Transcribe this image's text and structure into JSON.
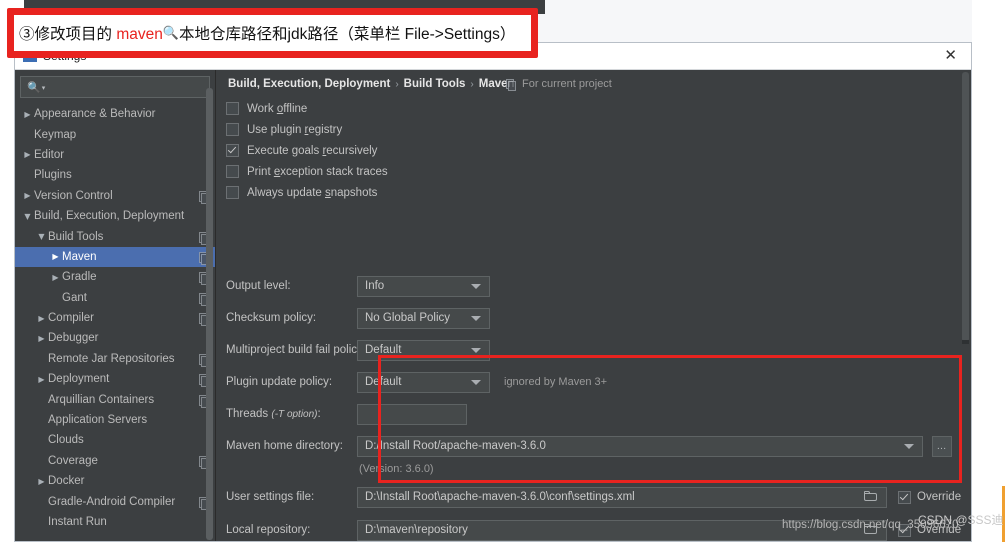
{
  "annotation": {
    "prefix": "③修改项目的 ",
    "keyword": "maven",
    "magnifier_icon": "search-icon",
    "suffix": "本地仓库路径和jdk路径（菜单栏 File->Settings）"
  },
  "dialog": {
    "title": "Settings",
    "close_label": "✕",
    "search_placeholder": "",
    "search_icon": "search-icon"
  },
  "sidebar": {
    "items": [
      {
        "label": "Appearance & Behavior",
        "arrow": "▶",
        "indent": 0,
        "badge": false,
        "selected": false
      },
      {
        "label": "Keymap",
        "arrow": "",
        "indent": 0,
        "badge": false,
        "selected": false
      },
      {
        "label": "Editor",
        "arrow": "▶",
        "indent": 0,
        "badge": false,
        "selected": false
      },
      {
        "label": "Plugins",
        "arrow": "",
        "indent": 0,
        "badge": false,
        "selected": false
      },
      {
        "label": "Version Control",
        "arrow": "▶",
        "indent": 0,
        "badge": true,
        "selected": false
      },
      {
        "label": "Build, Execution, Deployment",
        "arrow": "▼",
        "indent": 0,
        "badge": false,
        "selected": false
      },
      {
        "label": "Build Tools",
        "arrow": "▼",
        "indent": 1,
        "badge": true,
        "selected": false
      },
      {
        "label": "Maven",
        "arrow": "▶",
        "indent": 2,
        "badge": true,
        "selected": true
      },
      {
        "label": "Gradle",
        "arrow": "▶",
        "indent": 2,
        "badge": true,
        "selected": false
      },
      {
        "label": "Gant",
        "arrow": "",
        "indent": 2,
        "badge": true,
        "selected": false
      },
      {
        "label": "Compiler",
        "arrow": "▶",
        "indent": 1,
        "badge": true,
        "selected": false
      },
      {
        "label": "Debugger",
        "arrow": "▶",
        "indent": 1,
        "badge": false,
        "selected": false
      },
      {
        "label": "Remote Jar Repositories",
        "arrow": "",
        "indent": 1,
        "badge": true,
        "selected": false
      },
      {
        "label": "Deployment",
        "arrow": "▶",
        "indent": 1,
        "badge": true,
        "selected": false
      },
      {
        "label": "Arquillian Containers",
        "arrow": "",
        "indent": 1,
        "badge": true,
        "selected": false
      },
      {
        "label": "Application Servers",
        "arrow": "",
        "indent": 1,
        "badge": false,
        "selected": false
      },
      {
        "label": "Clouds",
        "arrow": "",
        "indent": 1,
        "badge": false,
        "selected": false
      },
      {
        "label": "Coverage",
        "arrow": "",
        "indent": 1,
        "badge": true,
        "selected": false
      },
      {
        "label": "Docker",
        "arrow": "▶",
        "indent": 1,
        "badge": false,
        "selected": false
      },
      {
        "label": "Gradle-Android Compiler",
        "arrow": "",
        "indent": 1,
        "badge": true,
        "selected": false
      },
      {
        "label": "Instant Run",
        "arrow": "",
        "indent": 1,
        "badge": false,
        "selected": false
      }
    ]
  },
  "content": {
    "breadcrumb": [
      "Build, Execution, Deployment",
      "Build Tools",
      "Maven"
    ],
    "breadcrumb_separator": "›",
    "for_current_project": "For current project",
    "checkboxes": [
      {
        "label_pre": "Work ",
        "label_key": "o",
        "label_post": "ffline",
        "checked": false
      },
      {
        "label_pre": "Use plugin ",
        "label_key": "r",
        "label_post": "egistry",
        "checked": false
      },
      {
        "label_pre": "Execute goals ",
        "label_key": "r",
        "label_post": "ecursively",
        "checked": true
      },
      {
        "label_pre": "Print ",
        "label_key": "e",
        "label_post": "xception stack traces",
        "checked": false
      },
      {
        "label_pre": "Always update ",
        "label_key": "s",
        "label_post": "napshots",
        "checked": false
      }
    ],
    "fields": {
      "output_level": {
        "label": "Output level:",
        "value": "Info"
      },
      "checksum_policy": {
        "label": "Checksum policy:",
        "value": "No Global Policy"
      },
      "multiproject_fail": {
        "label": "Multiproject build fail policy:",
        "value": "Default"
      },
      "plugin_update": {
        "label": "Plugin update policy:",
        "value": "Default",
        "note": "ignored by Maven 3+"
      },
      "threads": {
        "label_pre": "Threads ",
        "label_italic": "(-T option)",
        "label_post": ":",
        "value": ""
      },
      "maven_home": {
        "label": "Maven home directory:",
        "value": "D:/Install Root/apache-maven-3.6.0",
        "version_note": "(Version: 3.6.0)",
        "browse_label": "…"
      },
      "user_settings": {
        "label": "User settings file:",
        "value": "D:\\Install Root\\apache-maven-3.6.0\\conf\\settings.xml",
        "override_label": "Override",
        "override_checked": true
      },
      "local_repository": {
        "label": "Local repository:",
        "value": "D:\\maven\\repository",
        "override_label": "Override",
        "override_checked": true
      }
    }
  },
  "watermark": {
    "url": "https://blog.csdn.net/qq_35096670",
    "author": "CSDN @SSS迪"
  },
  "colors": {
    "accent_red": "#e8231f",
    "dialog_bg": "#3c3f41",
    "selection_blue": "#4b6eaf"
  }
}
